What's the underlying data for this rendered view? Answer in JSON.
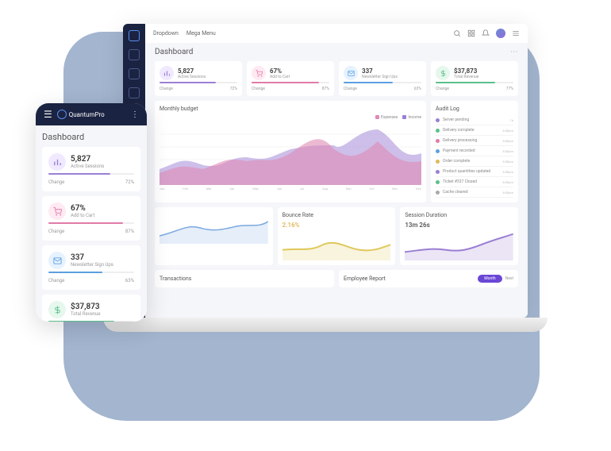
{
  "brand": "QuantumPro",
  "nav": {
    "dropdown": "Dropdown",
    "mega": "Mega Menu"
  },
  "page_title": "Dashboard",
  "cards": [
    {
      "icon": "bar-chart",
      "value": "5,827",
      "label": "Active Sessions",
      "change": "Change",
      "pct": "72%"
    },
    {
      "icon": "cart",
      "value": "67%",
      "label": "Add to Cart",
      "change": "Change",
      "pct": "87%"
    },
    {
      "icon": "mail",
      "value": "337",
      "label": "Newsletter Sign Ups",
      "change": "Change",
      "pct": "63%"
    },
    {
      "icon": "dollar",
      "value": "$37,873",
      "label": "Total Revenue",
      "change": "Change",
      "pct": "77%"
    }
  ],
  "budget": {
    "title": "Monthly budget",
    "legend": {
      "expenses": "Expenses",
      "income": "Income"
    }
  },
  "months": [
    "Jan",
    "Feb",
    "Mar",
    "Apr",
    "May",
    "Jun",
    "Jul",
    "Aug",
    "Sep",
    "Oct",
    "Nov",
    "Dec"
  ],
  "audit": {
    "title": "Audit Log",
    "items": [
      {
        "text": "Server pending",
        "time": "1h",
        "color": "#9b7fd4"
      },
      {
        "text": "Delivery complete",
        "time": "8:00pm",
        "color": "#5bc08a"
      },
      {
        "text": "Delivery processing",
        "time": "8:00pm",
        "color": "#e07ba8"
      },
      {
        "text": "Payment recorded",
        "time": "8:00pm",
        "color": "#5b9fe0"
      },
      {
        "text": "Order complete",
        "time": "8:00pm",
        "color": "#e0b85b"
      },
      {
        "text": "Product quantities updated",
        "time": "8:00pm",
        "color": "#9b7fd4"
      },
      {
        "text": "Ticket #327 Closed",
        "time": "8:00pm",
        "color": "#5bc08a"
      },
      {
        "text": "Cache cleared",
        "time": "8:00pm",
        "color": "#aaa"
      }
    ]
  },
  "mini": [
    {
      "title": "",
      "value": ""
    },
    {
      "title": "Bounce Rate",
      "value": "2.16%"
    },
    {
      "title": "Session Duration",
      "value": "13m 26s"
    }
  ],
  "row4": {
    "left": "Transactions",
    "right": "Employee Report",
    "pill": "Month",
    "next": "Next"
  },
  "chart_data": {
    "type": "area",
    "x": [
      "Jan",
      "Feb",
      "Mar",
      "Apr",
      "May",
      "Jun",
      "Jul",
      "Aug",
      "Sep",
      "Oct",
      "Nov",
      "Dec"
    ],
    "series": [
      {
        "name": "Expenses",
        "values": [
          15,
          25,
          20,
          30,
          35,
          25,
          40,
          65,
          45,
          35,
          55,
          30
        ],
        "color": "#e08bb5"
      },
      {
        "name": "Income",
        "values": [
          20,
          30,
          25,
          35,
          30,
          35,
          45,
          50,
          40,
          60,
          70,
          40
        ],
        "color": "#9b7fd4"
      }
    ],
    "ylim": [
      0,
      80
    ]
  }
}
